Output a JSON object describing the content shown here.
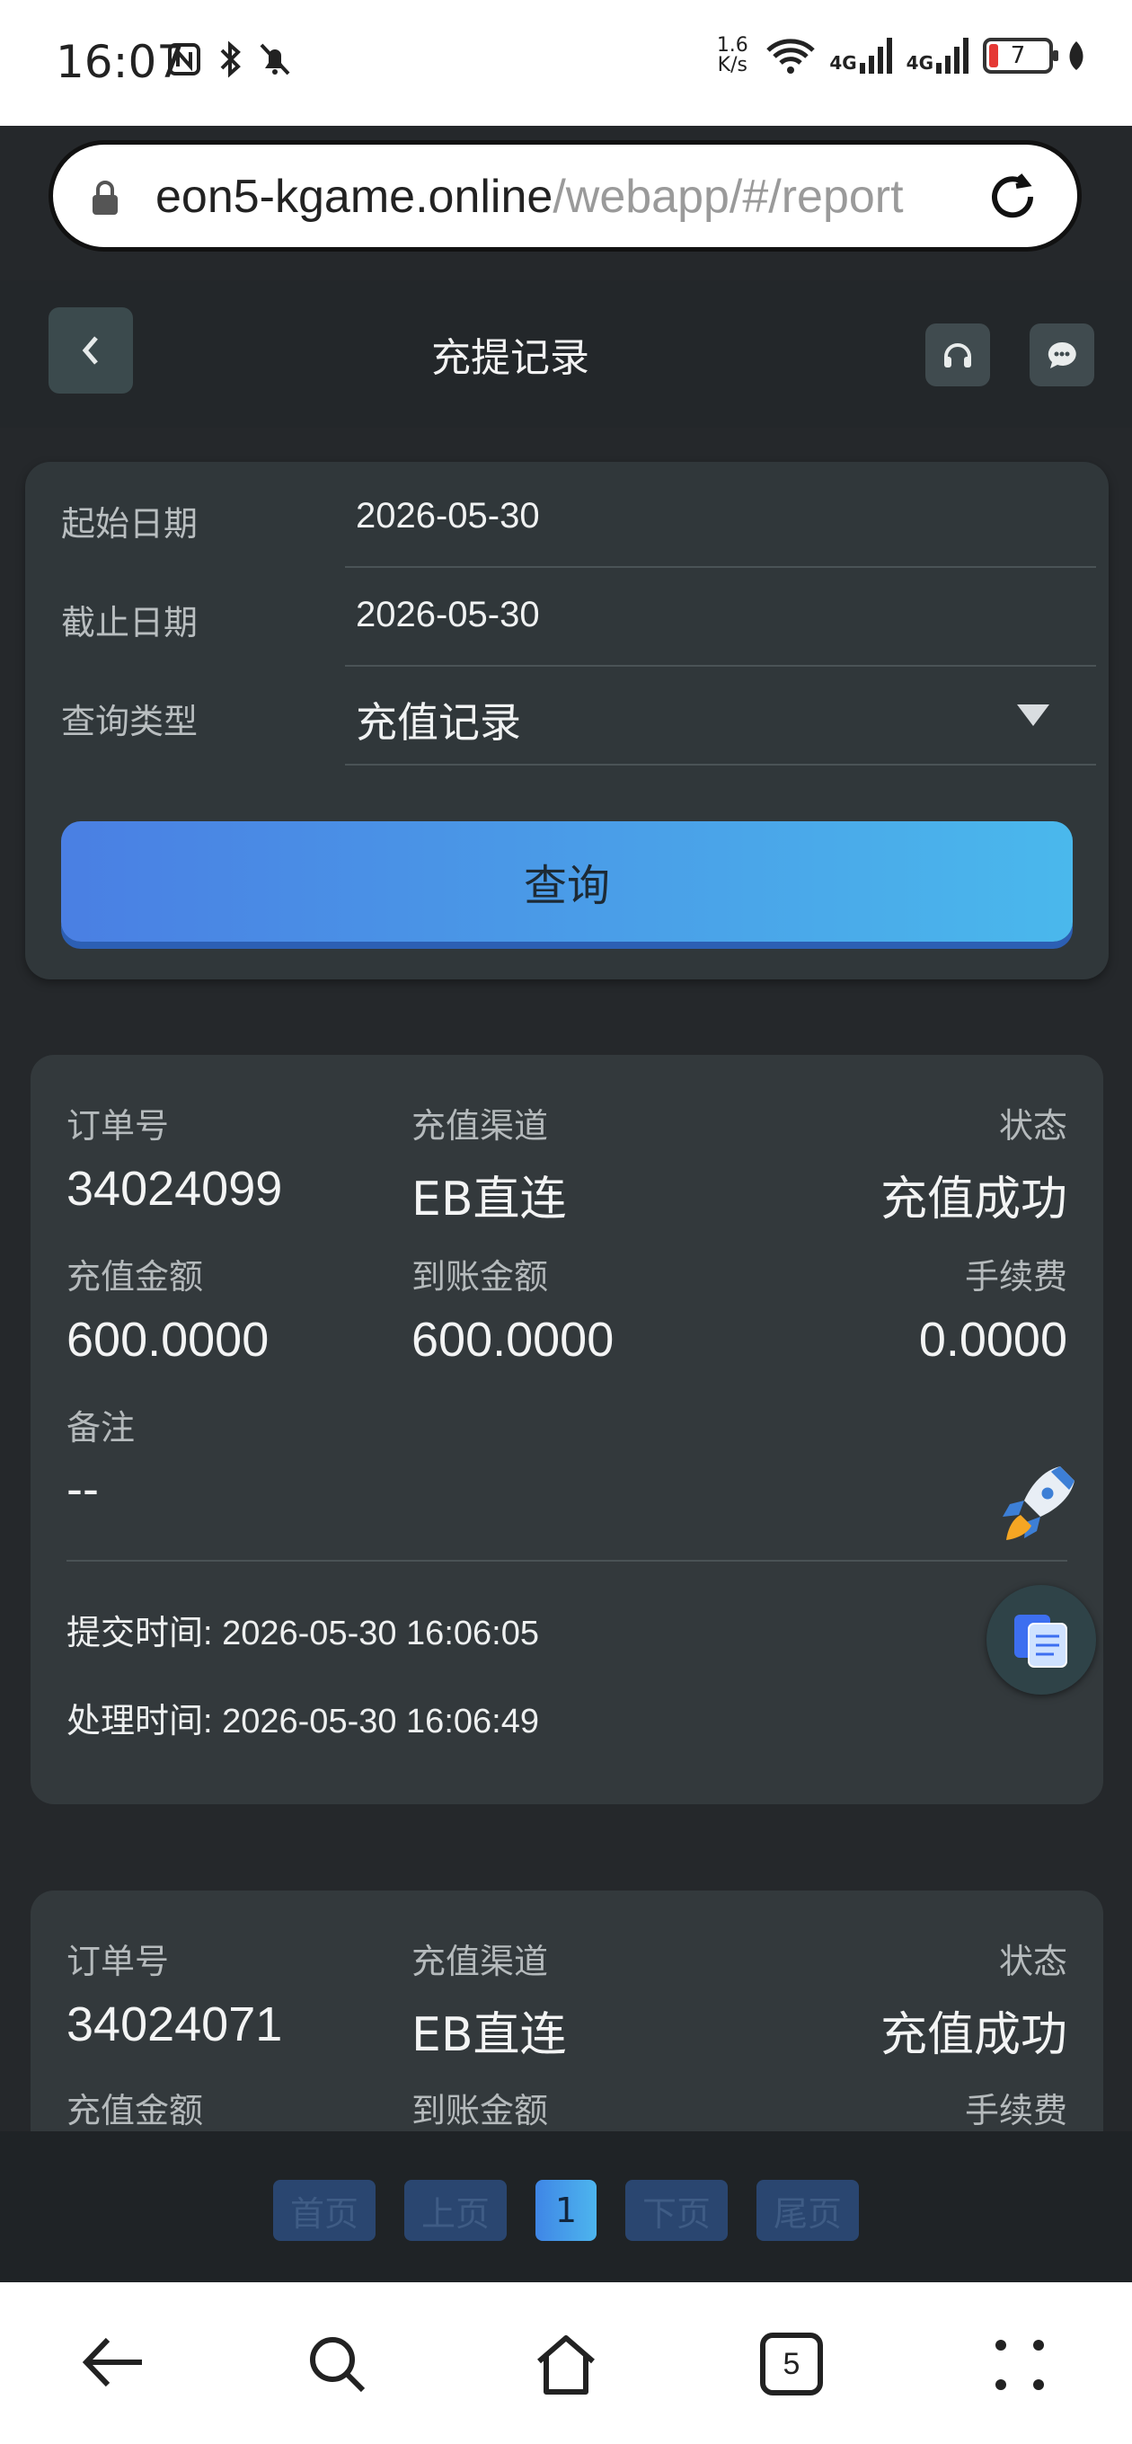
{
  "status_bar": {
    "time": "16:07",
    "net_speed_top": "1.6",
    "net_speed_bottom": "K/s",
    "signal1": "4G",
    "signal2": "4G",
    "battery": "7"
  },
  "browser": {
    "url_host": "eon5-kgame.online",
    "url_path": "/webapp/#/report",
    "tab_count": "5"
  },
  "header": {
    "title": "充提记录"
  },
  "filter": {
    "start_label": "起始日期",
    "start_value": "2026-05-30",
    "end_label": "截止日期",
    "end_value": "2026-05-30",
    "type_label": "查询类型",
    "type_value": "充值记录",
    "query_button": "查询"
  },
  "records": [
    {
      "order_label": "订单号",
      "order_value": "34024099",
      "channel_label": "充值渠道",
      "channel_value": "EB直连",
      "status_label": "状态",
      "status_value": "充值成功",
      "amount_label": "充值金额",
      "amount_value": "600.0000",
      "received_label": "到账金额",
      "received_value": "600.0000",
      "fee_label": "手续费",
      "fee_value": "0.0000",
      "note_label": "备注",
      "note_value": "--",
      "submit_time": "提交时间: 2026-05-30 16:06:05",
      "process_time": "处理时间: 2026-05-30 16:06:49"
    },
    {
      "order_label": "订单号",
      "order_value": "34024071",
      "channel_label": "充值渠道",
      "channel_value": "EB直连",
      "status_label": "状态",
      "status_value": "充值成功",
      "amount_label": "充值金额",
      "received_label": "到账金额",
      "fee_label": "手续费"
    }
  ],
  "pagination": {
    "first": "首页",
    "prev": "上页",
    "current": "1",
    "next": "下页",
    "last": "尾页"
  },
  "colors": {
    "accent_start": "#4a7fe3",
    "accent_end": "#4ab8ec",
    "card_bg": "#33393c",
    "page_bg": "#25282b"
  }
}
